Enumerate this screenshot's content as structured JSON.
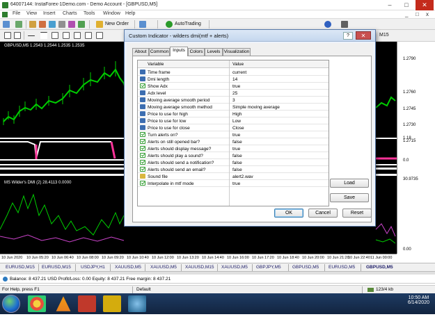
{
  "window": {
    "title": "64007144: InstaForex-1Demo.com - Demo Account - [GBPUSD,M5]",
    "minimize": "–",
    "maximize": "□",
    "close": "✕"
  },
  "menu": {
    "items": [
      "File",
      "View",
      "Insert",
      "Charts",
      "Tools",
      "Window",
      "Help"
    ],
    "mdi_minimize": "_",
    "mdi_restore": "□",
    "mdi_close": "x"
  },
  "toolbar": {
    "new_order": "New Order",
    "autotrading": "AutoTrading",
    "period_m15": "M15"
  },
  "chart": {
    "main_label": "GBPUSD,M5  1.2543 1.2544 1.2535 1.2535",
    "osc_label": "MS Wilder's DMI (2) 28.4113 0.0000",
    "price_levels": [
      "1.2790",
      "1.2760",
      "1.2745",
      "1.2730",
      "1.2715",
      "1.18",
      "0.0",
      "30.9735",
      "0.00"
    ],
    "time_labels": [
      "10 Jun 2020",
      "10 Jun 05:20",
      "10 Jun 06:40",
      "10 Jun 08:00",
      "10 Jun 09:20",
      "10 Jun 10:40",
      "10 Jun 12:00",
      "10 Jun 13:20",
      "10 Jun 14:40",
      "10 Jun 16:00",
      "10 Jun 17:20",
      "10 Jun 18:40",
      "10 Jun 20:00",
      "10 Jun 21:20",
      "10 Jun 22:40",
      "11 Jun 00:00"
    ],
    "colors": {
      "candles": "#00cc00",
      "dmi_plus": "#00cc00",
      "dmi_minus": "#cc44cc",
      "stripe_pink": "#ff3399"
    }
  },
  "symbol_tabs": [
    "EURUSD,M15",
    "EURUSD,M15",
    "USDJPY,H1",
    "XAUUSD,M5",
    "XAUUSD,M5",
    "XAUUSD,M15",
    "XAUUSD,M5",
    "GBPJPY,M5",
    "GBPUSD,M5",
    "EURUSD,M5",
    "GBPUSD,M5"
  ],
  "balance": {
    "text": "Balance: 8 437.21 USD  Profit/Loss: 0.00  Equity: 8 437.21  Free margin: 8 437.21"
  },
  "status": {
    "help": "For Help, press F1",
    "profile": "Default",
    "traffic": "123/4 kb"
  },
  "taskbar": {
    "time": "10:50 AM",
    "date": "6/14/2020"
  },
  "dialog": {
    "title": "Custom Indicator - wilders dmi(mtf + alerts)",
    "help": "?",
    "close": "✕",
    "tabs": [
      "About",
      "Common",
      "Inputs",
      "Colors",
      "Levels",
      "Visualization"
    ],
    "active_tab": "Inputs",
    "col_variable": "Variable",
    "col_value": "Value",
    "rows": [
      {
        "type": "num",
        "name": "Time frame",
        "value": "current"
      },
      {
        "type": "num",
        "name": "Dmi length",
        "value": "14"
      },
      {
        "type": "bool",
        "name": "Show Adx",
        "value": "true"
      },
      {
        "type": "num",
        "name": "Adx level",
        "value": "25"
      },
      {
        "type": "num",
        "name": "Moving average smooth period",
        "value": "3"
      },
      {
        "type": "enum",
        "name": "Moving average smooth method",
        "value": "Simple moving average"
      },
      {
        "type": "enum",
        "name": "Price to use for high",
        "value": "High"
      },
      {
        "type": "enum",
        "name": "Price to use for low",
        "value": "Low"
      },
      {
        "type": "enum",
        "name": "Price to use for close",
        "value": "Close"
      },
      {
        "type": "bool",
        "name": "Turn alerts on?",
        "value": "true"
      },
      {
        "type": "bool",
        "name": "Alerts on still opened bar?",
        "value": "false"
      },
      {
        "type": "bool",
        "name": "Alerts should display message?",
        "value": "true"
      },
      {
        "type": "bool",
        "name": "Alerts should play a sound?",
        "value": "false"
      },
      {
        "type": "bool",
        "name": "Alerts should send a notification?",
        "value": "false"
      },
      {
        "type": "bool",
        "name": "Alerts should send an email?",
        "value": "false"
      },
      {
        "type": "str",
        "name": "Sound file",
        "value": "alert2.wav"
      },
      {
        "type": "bool",
        "name": "Interpolate in mtf mode",
        "value": "true"
      }
    ],
    "buttons": {
      "load": "Load",
      "save": "Save",
      "ok": "OK",
      "cancel": "Cancel",
      "reset": "Reset"
    }
  }
}
